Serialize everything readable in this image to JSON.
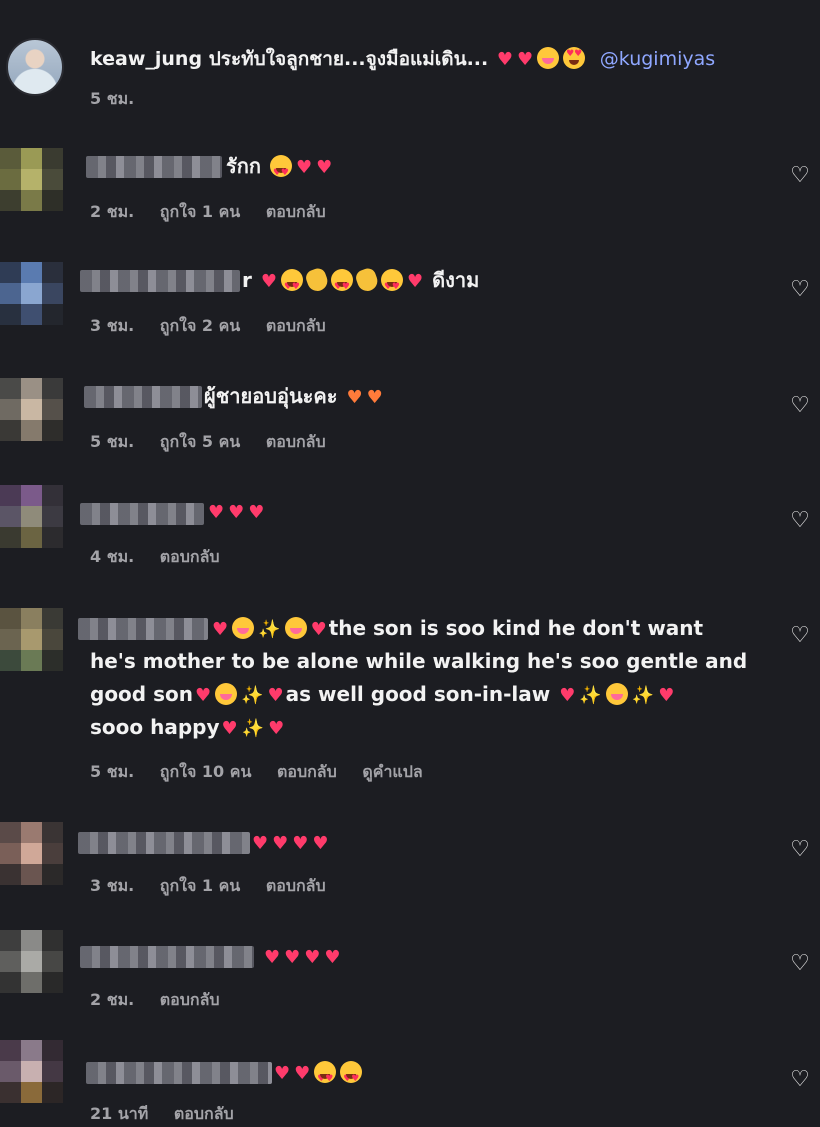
{
  "caption": {
    "username": "keaw_jung",
    "text": "ประทับใจลูกชาย...จูงมือแม่เดิน...",
    "mention": "@kugimiyas",
    "time": "5 ชม."
  },
  "like_icon": "heart-outline-icon",
  "comments": [
    {
      "text": "รักก",
      "time": "2 ชม.",
      "likes": "ถูกใจ 1 คน",
      "reply": "ตอบกลับ",
      "translate": ""
    },
    {
      "text": "ดีงาม",
      "time": "3 ชม.",
      "likes": "ถูกใจ 2 คน",
      "reply": "ตอบกลับ",
      "translate": ""
    },
    {
      "text": "ผู้ชายอบอุ่นะคะ",
      "time": "5 ชม.",
      "likes": "ถูกใจ 5 คน",
      "reply": "ตอบกลับ",
      "translate": ""
    },
    {
      "text": "",
      "time": "4 ชม.",
      "likes": "",
      "reply": "ตอบกลับ",
      "translate": ""
    },
    {
      "text_parts": [
        "the son is soo kind he don't want",
        "he's mother to be alone while walking he's soo gentle and",
        "good son",
        "as well good son-in-law",
        "sooo happy"
      ],
      "time": "5 ชม.",
      "likes": "ถูกใจ 10 คน",
      "reply": "ตอบกลับ",
      "translate": "ดูคำแปล"
    },
    {
      "text": "",
      "time": "3 ชม.",
      "likes": "ถูกใจ 1 คน",
      "reply": "ตอบกลับ",
      "translate": ""
    },
    {
      "text": "",
      "time": "2 ชม.",
      "likes": "",
      "reply": "ตอบกลับ",
      "translate": ""
    },
    {
      "text": "",
      "time": "21 นาที",
      "likes": "",
      "reply": "ตอบกลับ",
      "translate": ""
    }
  ]
}
